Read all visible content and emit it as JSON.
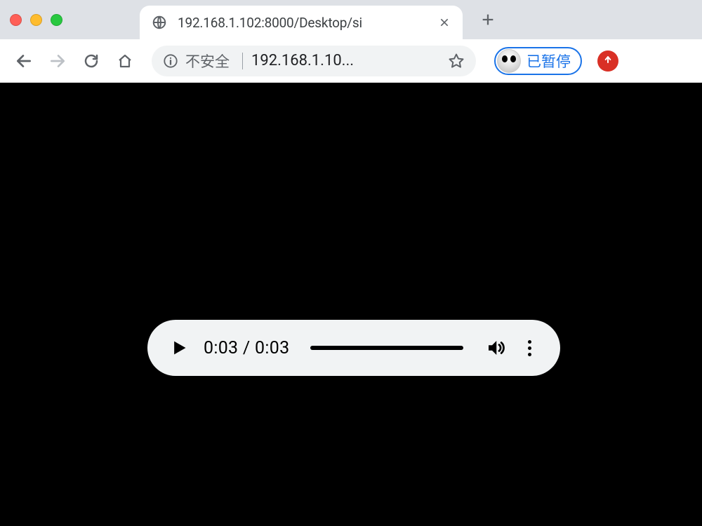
{
  "tab": {
    "title": "192.168.1.102:8000/Desktop/si"
  },
  "omnibox": {
    "insecure_label": "不安全",
    "url": "192.168.1.10..."
  },
  "profile": {
    "status_label": "已暂停"
  },
  "player": {
    "current_time": "0:03",
    "separator": " / ",
    "duration": "0:03"
  }
}
